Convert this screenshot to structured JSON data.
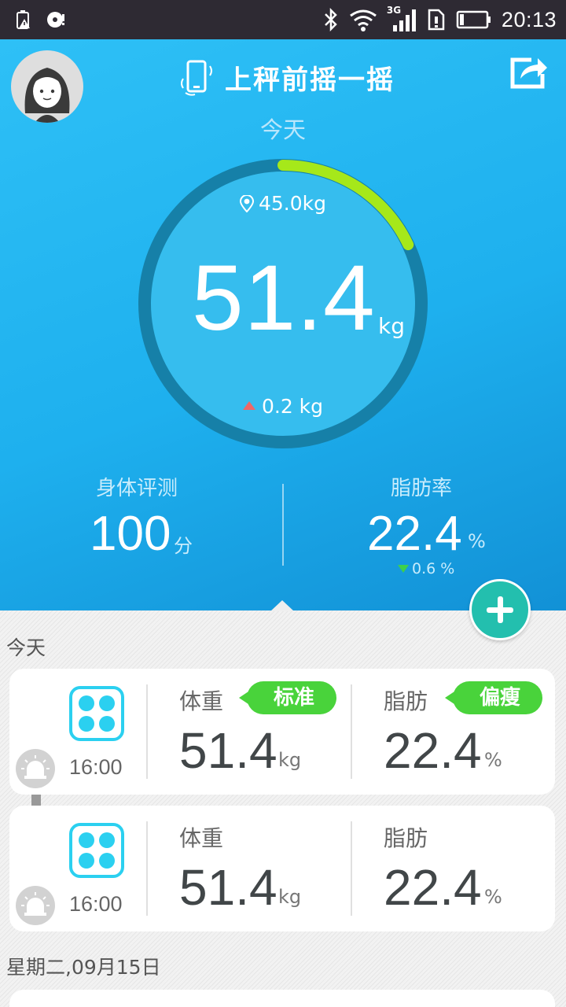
{
  "status_bar": {
    "time": "20:13",
    "network": "3G"
  },
  "header": {
    "title": "上秤前摇一摇",
    "date_label": "今天"
  },
  "gauge": {
    "target": "45.0kg",
    "weight": "51.4",
    "unit": "kg",
    "change": "0.2 kg",
    "progress": 0.18
  },
  "metrics": {
    "body_eval": {
      "label": "身体评测",
      "value": "100",
      "unit": "分"
    },
    "body_fat": {
      "label": "脂肪率",
      "value": "22.4",
      "unit": "%",
      "change": "0.6 %"
    }
  },
  "sections": [
    {
      "label": "今天",
      "records": [
        {
          "time": "16:00",
          "weight_label": "体重",
          "weight": "51.4",
          "weight_unit": "kg",
          "weight_badge": "标准",
          "fat_label": "脂肪",
          "fat": "22.4",
          "fat_unit": "%",
          "fat_badge": "偏瘦"
        },
        {
          "time": "16:00",
          "weight_label": "体重",
          "weight": "51.4",
          "weight_unit": "kg",
          "fat_label": "脂肪",
          "fat": "22.4",
          "fat_unit": "%"
        }
      ]
    },
    {
      "label": "星期二,09月15日"
    }
  ],
  "colors": {
    "accent": "#23bfae",
    "badge": "#49d33b",
    "ring_progress": "#a6e81a",
    "ring_track": "#1680a8"
  }
}
